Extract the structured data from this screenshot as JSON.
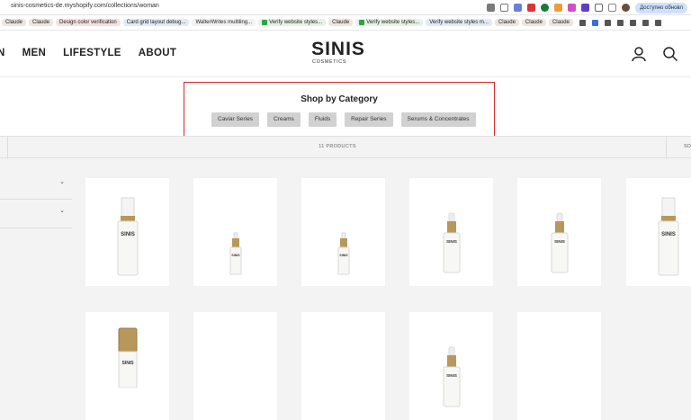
{
  "browser": {
    "url": "sinis-cosmetics-de.myshopify.com/collections/woman",
    "profile_label": "Доступно обновл",
    "bookmarks": [
      {
        "label": "Claude",
        "color": "#f0e4e0"
      },
      {
        "label": "Claude",
        "color": "#f0e4e0"
      },
      {
        "label": "Design color verification",
        "color": "#f7e0de"
      },
      {
        "label": "Card grid layout debug...",
        "color": "#e3e9f8"
      },
      {
        "label": "WalterWrites multiling...",
        "color": "#f2f2f2"
      },
      {
        "label": "Verify website styles...",
        "color": "#e5f2e5",
        "check": true
      },
      {
        "label": "Claude",
        "color": "#f0e4e0"
      },
      {
        "label": "Verify website styles...",
        "color": "#e5f2e5",
        "check": true
      },
      {
        "label": "Verify website styles m...",
        "color": "#e3e9f8"
      },
      {
        "label": "Claude",
        "color": "#f0e4e0"
      },
      {
        "label": "Claude",
        "color": "#f0e4e0"
      },
      {
        "label": "Claude",
        "color": "#f0e4e0"
      }
    ]
  },
  "header": {
    "nav": [
      "N",
      "MEN",
      "LIFESTYLE",
      "ABOUT"
    ],
    "logo_main": "SINIS",
    "logo_sub": "COSMETICS"
  },
  "category": {
    "title": "Shop by Category",
    "buttons": [
      "Caviar Series",
      "Creams",
      "Fluids",
      "Repair Series",
      "Serums & Concentrates"
    ],
    "highlight_color": "#d42a2a"
  },
  "toolbar": {
    "count": "11 PRODUCTS",
    "sort": "SO"
  },
  "products": [
    {
      "type": "pump"
    },
    {
      "type": "small-dropper"
    },
    {
      "type": "small-dropper"
    },
    {
      "type": "dropper"
    },
    {
      "type": "dropper"
    },
    {
      "type": "pump"
    },
    {
      "type": "gold-cap"
    },
    {
      "type": "empty"
    },
    {
      "type": "empty"
    },
    {
      "type": "dropper-partial"
    },
    {
      "type": "empty"
    }
  ]
}
